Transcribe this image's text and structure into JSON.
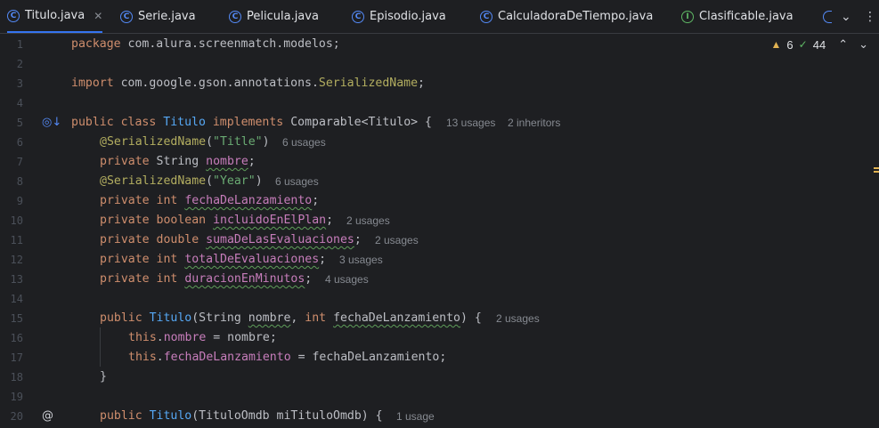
{
  "tabs": [
    {
      "label": "Titulo.java",
      "kind": "class",
      "active": true
    },
    {
      "label": "Serie.java",
      "kind": "class"
    },
    {
      "label": "Pelicula.java",
      "kind": "class"
    },
    {
      "label": "Episodio.java",
      "kind": "class"
    },
    {
      "label": "CalculadoraDeTiempo.java",
      "kind": "class"
    },
    {
      "label": "Clasificable.java",
      "kind": "interface"
    }
  ],
  "inspections": {
    "warnings": "6",
    "ok": "44"
  },
  "lines": {
    "l1": {
      "n": "1"
    },
    "l2": {
      "n": "2"
    },
    "l3": {
      "n": "3"
    },
    "l4": {
      "n": "4"
    },
    "l5": {
      "n": "5",
      "hint1": "13 usages",
      "hint2": "2 inheritors"
    },
    "l6": {
      "n": "6",
      "hint": "6 usages"
    },
    "l7": {
      "n": "7"
    },
    "l8": {
      "n": "8",
      "hint": "6 usages"
    },
    "l9": {
      "n": "9"
    },
    "l10": {
      "n": "10",
      "hint": "2 usages"
    },
    "l11": {
      "n": "11",
      "hint": "2 usages"
    },
    "l12": {
      "n": "12",
      "hint": "3 usages"
    },
    "l13": {
      "n": "13",
      "hint": "4 usages"
    },
    "l14": {
      "n": "14"
    },
    "l15": {
      "n": "15",
      "hint": "2 usages"
    },
    "l16": {
      "n": "16"
    },
    "l17": {
      "n": "17"
    },
    "l18": {
      "n": "18"
    },
    "l19": {
      "n": "19"
    },
    "l20": {
      "n": "20",
      "hint": "1 usage"
    }
  },
  "code": {
    "package_kw": "package",
    "package_name": " com.alura.screenmatch.modelos;",
    "import_kw": "import",
    "import_path": " com.google.gson.annotations.",
    "import_ann": "SerializedName",
    "public": "public",
    "class": "class",
    "private": "private",
    "implements": "implements",
    "int": "int",
    "boolean": "boolean",
    "double": "double",
    "this": "this",
    "class_name": "Titulo",
    "comparable": " Comparable<Titulo> {",
    "annotation": "@SerializedName",
    "ann_title": "\"Title\"",
    "ann_year": "\"Year\"",
    "string_type": "String",
    "f_nombre": "nombre",
    "f_fecha": "fechaDeLanzamiento",
    "f_incluido": "incluidoEnElPlan",
    "f_suma": "sumaDeLasEvaluaciones",
    "f_total": "totalDeEvaluaciones",
    "f_duracion": "duracionEnMinutos",
    "ctor_name": "Titulo",
    "ctor_params_a": "(String ",
    "ctor_params_b": ", ",
    "ctor_params_c": ") {",
    "assign_nombre": " = nombre;",
    "assign_fecha": " = fechaDeLanzamiento;",
    "close_brace": "}",
    "ctor2_params": "(TituloOmdb miTituloOmdb) {"
  }
}
